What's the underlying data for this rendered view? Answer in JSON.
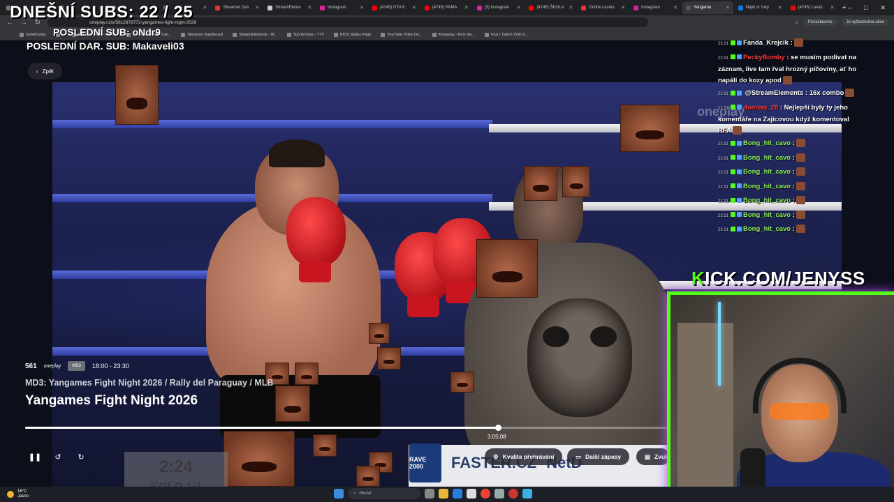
{
  "browser": {
    "tabs": [
      {
        "label": "",
        "color": "#777"
      },
      {
        "label": "",
        "color": "#777"
      },
      {
        "label": "",
        "color": "#777"
      },
      {
        "label": "",
        "color": "#777"
      },
      {
        "label": "Streamer Das",
        "color": "#e33"
      },
      {
        "label": "StreamEleme",
        "color": "#ccc"
      },
      {
        "label": "Instagram",
        "color": "#d6249f"
      },
      {
        "label": "(4745) GTA 6",
        "color": "#f00"
      },
      {
        "label": "(4745) PAMA",
        "color": "#f00"
      },
      {
        "label": "(3) Instagram",
        "color": "#d6249f"
      },
      {
        "label": "(4745) ŠKOLA",
        "color": "#f00"
      },
      {
        "label": "Online casino",
        "color": "#e33"
      },
      {
        "label": "Instagram",
        "color": "#d6249f"
      },
      {
        "label": "Yangame",
        "color": "#555",
        "active": true
      },
      {
        "label": "Najdi si 'luky",
        "color": "#1a73e8"
      },
      {
        "label": "(4745) Lukáš",
        "color": "#f00"
      }
    ],
    "url": "oneplay.cz/v/5612978772-yangames-fight-night-2026",
    "profile_name": "Pozastaveno",
    "profile_action": "Je vyžadována akce",
    "bookmarks": [
      "Vyšetřování",
      "",
      "File Converter - Free...",
      "The best ChatBot an...",
      "Streamer Dashboard",
      "StreamElements - M...",
      "Top Emotes - 7TV",
      "KICK Status Page",
      "YouTube Video Do...",
      "Kickaway - Kick Giv...",
      "Kick / Twitch VOD d..."
    ]
  },
  "overlay": {
    "subs": "DNEŠNÍ SUBS: 22 / 25",
    "last_sub": "POSLEDNÍ SUB: oNdr9",
    "last_dar": "POSLEDNÍ DAR. SUB: Makaveli03",
    "kick_prefix": "K",
    "kick_rest": "ICK.COM/JENYSS"
  },
  "player": {
    "back_label": "Zpět",
    "channel_number": "561",
    "channel_logo": "oneplay",
    "channel_badge": "MD3",
    "time_range": "18:00 - 23:30",
    "subtitle": "MD3: Yangames Fight Night 2026 / Rally del Paraguay / MLB",
    "title": "Yangames Fight Night 2026",
    "progress": 0.736,
    "current_time": "3:05:08",
    "quality_label": "Kvalita přehrávání",
    "more_label": "Další zápasy",
    "sound_label": "Zvuk",
    "watermark": "oneplay",
    "score_time": "2:24",
    "score_round": "KOLO 1/4",
    "sponsor1": "FASTER.CZ",
    "sponsor2": "NetD",
    "rave": "RAVE 2000"
  },
  "chat": [
    {
      "time": "23:31",
      "user": "Fanda_Krejcik",
      "color": "#ffffff",
      "text": ":"
    },
    {
      "time": "23:31",
      "user": "PeckyBomby",
      "color": "#ff3b3b",
      "text": ": se musím podívat na záznam, live tam řval hrozný píčoviny, ať ho napálí do kozy apod"
    },
    {
      "time": "23:31",
      "user": "",
      "color": "#ffffff",
      "text": "@StreamElements : 16x combo"
    },
    {
      "time": "23:31",
      "user": "domino_28",
      "color": "#ff3b3b",
      "text": ": Nejlepší byly ty jeho komentáře na Zajícovou když komentoval RFA"
    },
    {
      "time": "23:31",
      "user": "Bong_hit_cavo",
      "color": "#8df05a",
      "text": ":"
    },
    {
      "time": "23:31",
      "user": "Bong_hit_cavo",
      "color": "#8df05a",
      "text": ":"
    },
    {
      "time": "23:31",
      "user": "Bong_hit_cavo",
      "color": "#8df05a",
      "text": ":"
    },
    {
      "time": "23:31",
      "user": "Bong_hit_cavo",
      "color": "#8df05a",
      "text": ":"
    },
    {
      "time": "23:31",
      "user": "Bong_hit_cavo",
      "color": "#8df05a",
      "text": ":"
    },
    {
      "time": "23:31",
      "user": "Bong_hit_cavo",
      "color": "#8df05a",
      "text": ":"
    },
    {
      "time": "23:31",
      "user": "Bong_hit_cavo",
      "color": "#8df05a",
      "text": ":"
    }
  ],
  "taskbar": {
    "temperature": "16°C",
    "weather_text": "Jasno",
    "search_placeholder": "Hledat"
  },
  "colors": {
    "kick_green": "#53fc18",
    "glove_red": "#d01a22"
  }
}
